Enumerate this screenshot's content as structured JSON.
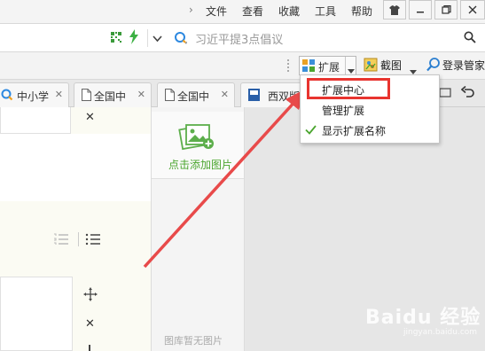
{
  "menubar": {
    "chevron": "›",
    "items": [
      "文件",
      "查看",
      "收藏",
      "工具",
      "帮助"
    ]
  },
  "addressbar": {
    "search_placeholder": "习近平提3点倡议"
  },
  "toolbar": {
    "extensions_label": "扩展",
    "screenshot_label": "截图",
    "login_label": "登录管家"
  },
  "tabs": [
    {
      "label": "中小学"
    },
    {
      "label": "全国中"
    },
    {
      "label": "全国中"
    },
    {
      "label": "西双版"
    }
  ],
  "dropdown": {
    "items": [
      "扩展中心",
      "管理扩展",
      "显示扩展名称"
    ],
    "highlighted": "扩展中心",
    "checked": "显示扩展名称"
  },
  "image_panel": {
    "add_label": "点击添加图片",
    "empty_label": "图库暂无图片"
  },
  "watermark": {
    "brand": "Baidu 经验",
    "sub": "jingyan.baidu.com"
  },
  "colors": {
    "accent_green": "#4aa52e",
    "highlight_red": "#e8342f",
    "arrow_red": "#e84a4a"
  }
}
